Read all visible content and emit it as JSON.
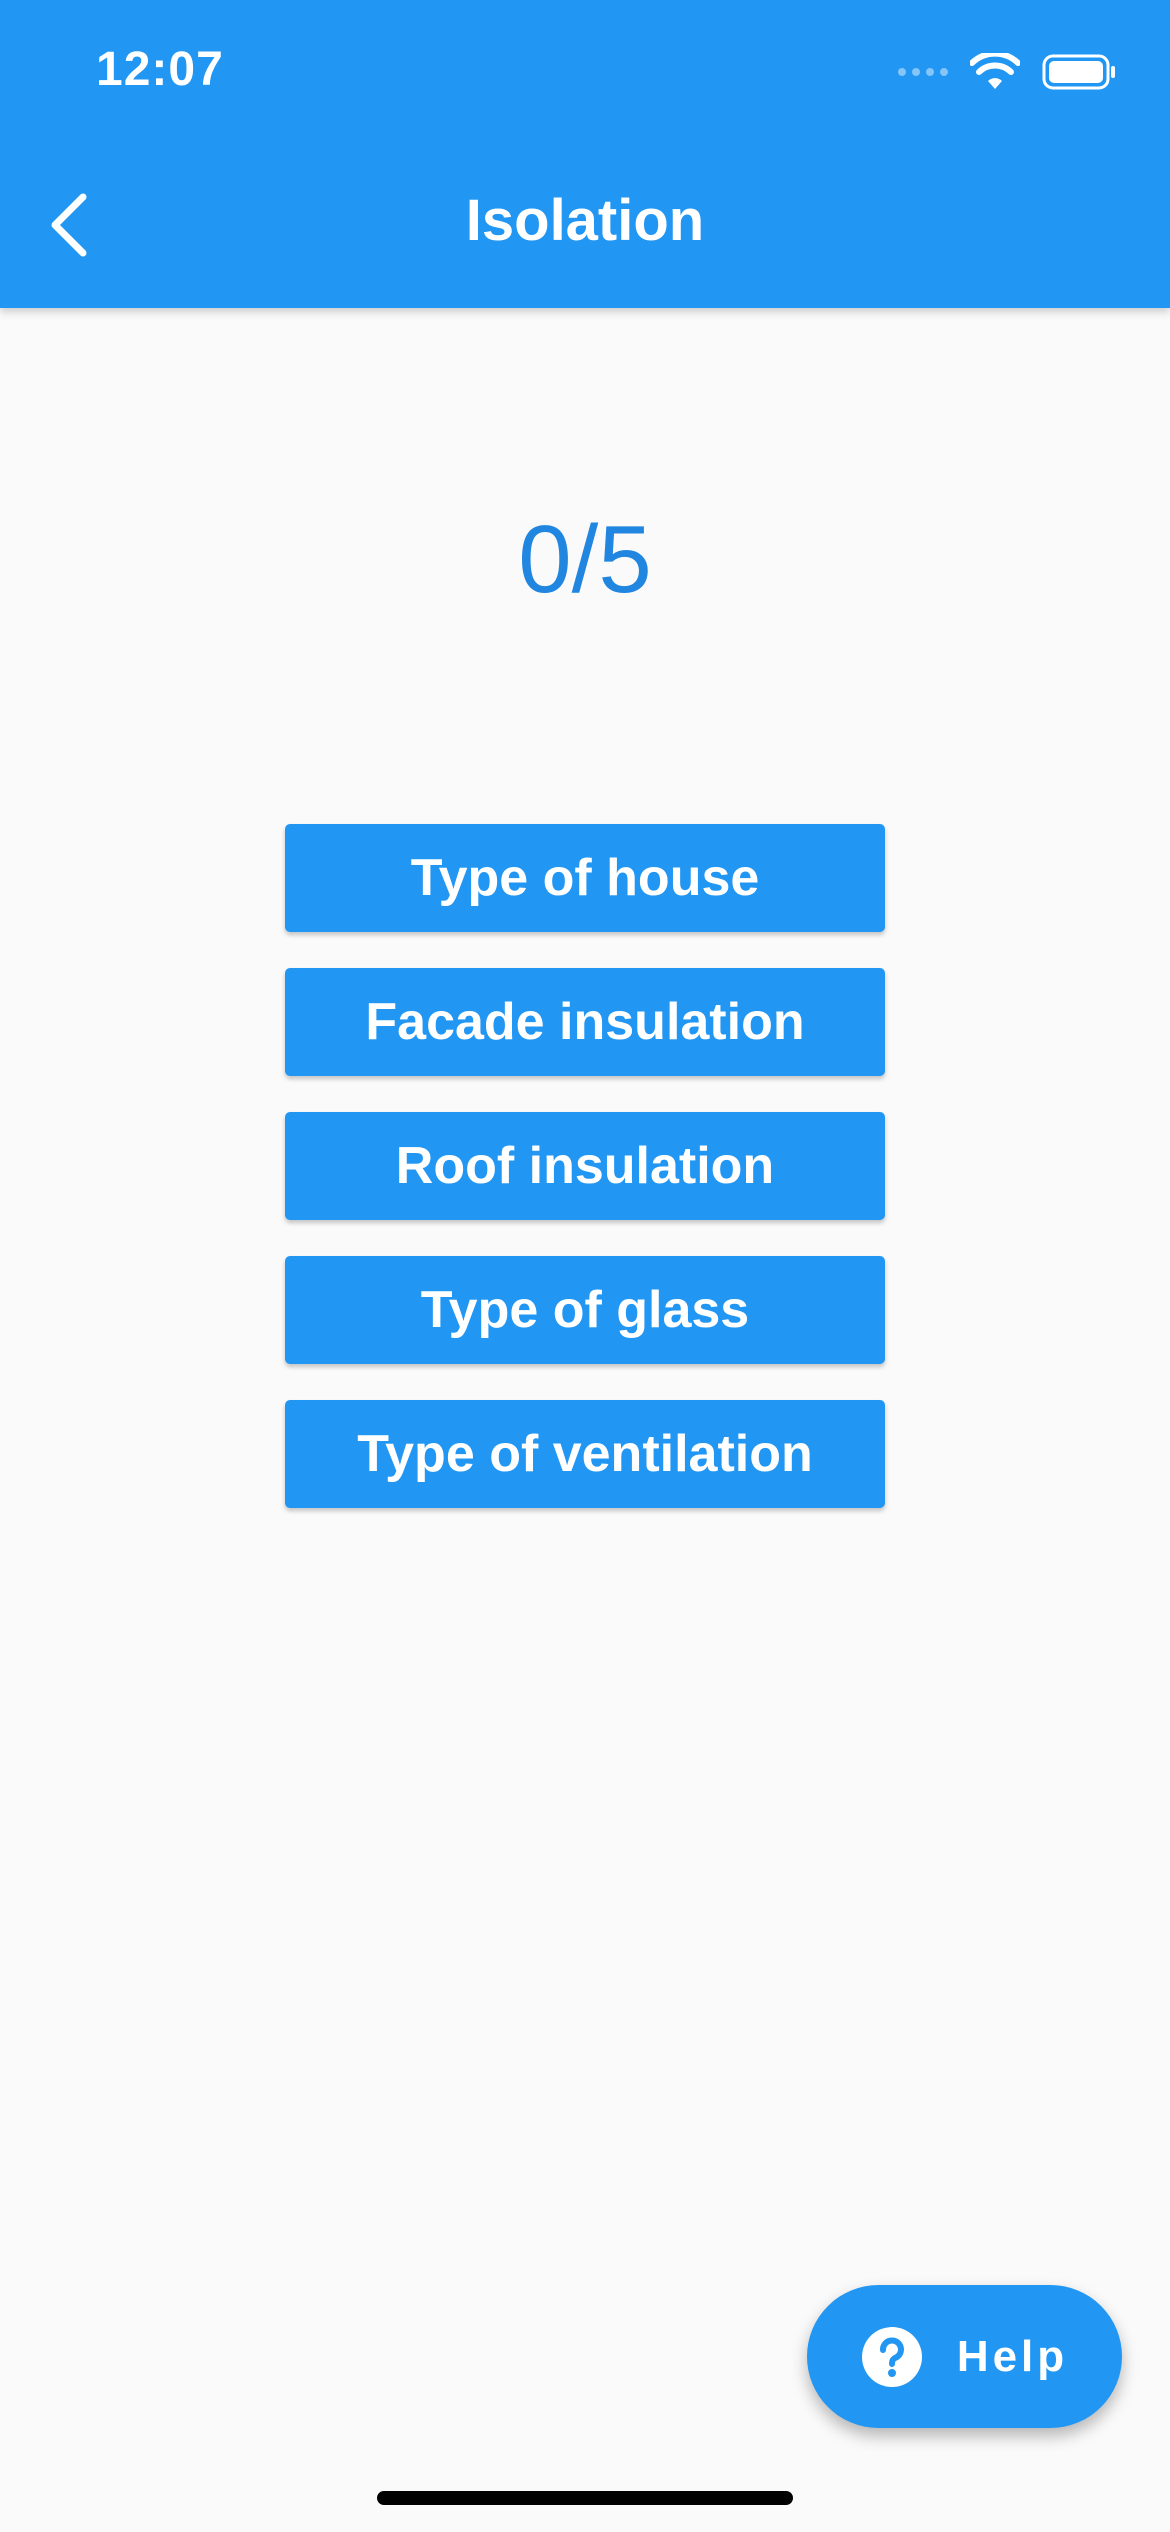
{
  "status_bar": {
    "time": "12:07"
  },
  "app_bar": {
    "title": "Isolation",
    "back_icon": "chevron-left-icon"
  },
  "progress": {
    "text": "0/5"
  },
  "menu": {
    "items": [
      {
        "label": "Type of house"
      },
      {
        "label": "Facade insulation"
      },
      {
        "label": "Roof insulation"
      },
      {
        "label": "Type of glass"
      },
      {
        "label": "Type of ventilation"
      }
    ]
  },
  "help_fab": {
    "label": "Help",
    "icon": "question-circle-icon"
  },
  "colors": {
    "primary": "#2196f3",
    "progress_text": "#2186e0",
    "background": "#fafafa"
  }
}
